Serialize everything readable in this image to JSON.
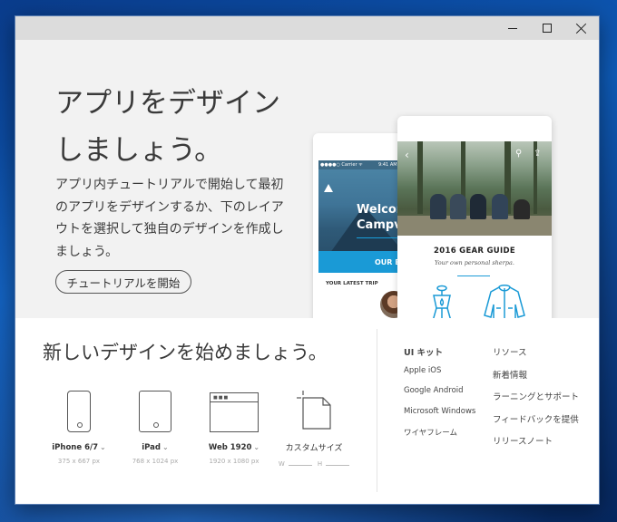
{
  "window": {
    "controls": {
      "minimize": "minimize",
      "maximize": "maximize",
      "close": "close"
    }
  },
  "hero": {
    "title": "アプリをデザインしましょう。",
    "description": "アプリ内チュートリアルで開始して最初のアプリをデザインするか、下のレイアウトを選択して独自のデザインを作成しましょう。",
    "tutorial_button": "チュートリアルを開始"
  },
  "preview": {
    "back_phone": {
      "status_carrier": "●●●●○ Carrier ᯤ",
      "status_time": "9:41 AM",
      "welcome": "Welcome to\nCampvibes",
      "button": "OUR BLOG",
      "section": "YOUR LATEST TRIP"
    },
    "front_phone": {
      "title": "2016 GEAR GUIDE",
      "subtitle": "Your own personal sherpa."
    }
  },
  "start": {
    "title": "新しいデザインを始めましょう。",
    "devices": [
      {
        "label": "iPhone 6/7",
        "size": "375 x 667 px"
      },
      {
        "label": "iPad",
        "size": "768 x 1024 px"
      },
      {
        "label": "Web 1920",
        "size": "1920 x 1080 px"
      }
    ],
    "custom": {
      "label": "カスタムサイズ",
      "w": "W",
      "h": "H"
    }
  },
  "links": {
    "left": [
      "UI キット",
      "Apple iOS",
      "Google Android",
      "Microsoft Windows",
      "ワイヤフレーム"
    ],
    "right": [
      "リソース",
      "新着情報",
      "ラーニングとサポート",
      "フィードバックを提供",
      "リリースノート"
    ]
  }
}
